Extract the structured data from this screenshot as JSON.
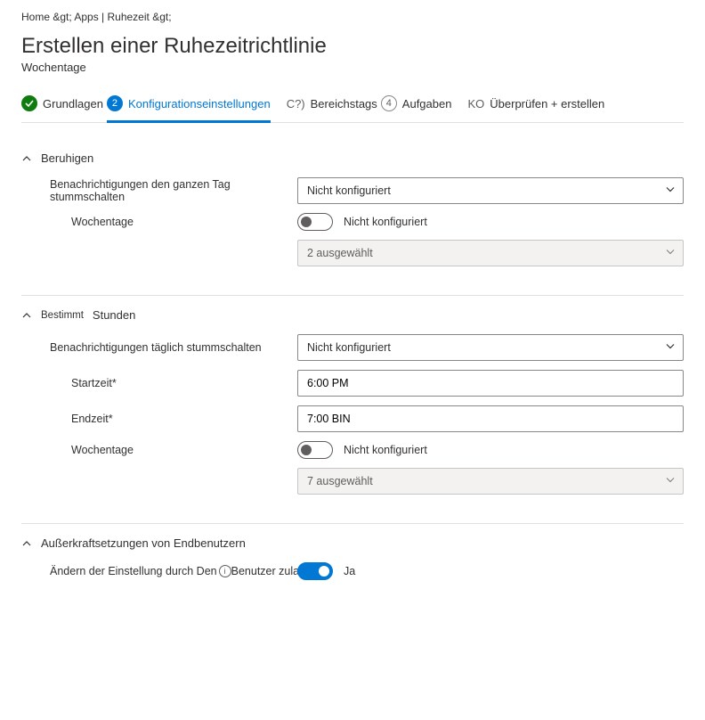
{
  "breadcrumb": "Home &gt;  Apps | Ruhezeit &gt;",
  "title": "Erstellen einer Ruhezeitrichtlinie",
  "subtitle": "Wochentage",
  "steps": {
    "s1": "Grundlagen",
    "s2_badge": "2",
    "s2": "Konfigurationseinstellungen",
    "s3_badge": "C?)",
    "s3": "Bereichstags",
    "s4_badge": "4",
    "s4": "Aufgaben",
    "s5_badge": "KO",
    "s5": "Überprüfen + erstellen"
  },
  "section1": {
    "title": "Beruhigen",
    "row1_label": "Benachrichtigungen den ganzen Tag stummschalten",
    "row1_value": "Nicht konfiguriert",
    "row2_label": "Wochentage",
    "row2_toggle_label": "Nicht konfiguriert",
    "row2_select": "2 ausgewählt"
  },
  "section2": {
    "title_a": "Bestimmt",
    "title_b": "Stunden",
    "row1_label": "Benachrichtigungen täglich stummschalten",
    "row1_value": "Nicht konfiguriert",
    "row2_label": "Startzeit*",
    "row2_value": "6:00 PM",
    "row3_label": "Endzeit*",
    "row3_value": "7:00 BIN",
    "row4_label": "Wochentage",
    "row4_toggle_label": "Nicht konfiguriert",
    "row4_select": "7 ausgewählt"
  },
  "section3": {
    "title": "Außerkraftsetzungen von Endbenutzern",
    "row1_label_a": "Ändern der Einstellung durch Den",
    "row1_label_b": "Benutzer zulassen",
    "row1_toggle_label": "Ja"
  }
}
